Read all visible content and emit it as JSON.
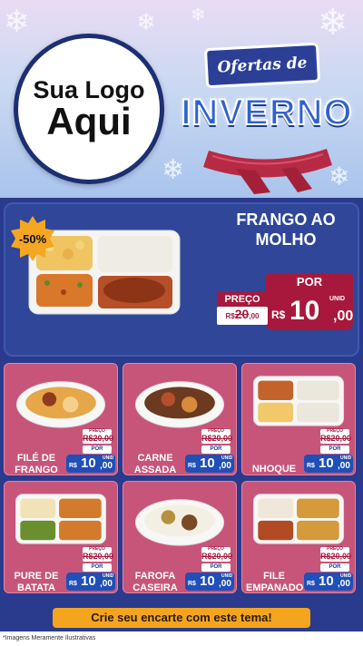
{
  "header": {
    "logo_line1": "Sua Logo",
    "logo_line2": "Aqui",
    "ofertas": "Ofertas de",
    "inverno": "INVERNO"
  },
  "hero": {
    "badge": "-50%",
    "title_line1": "FRANGO AO",
    "title_line2": "MOLHO",
    "por_label": "POR",
    "preco_label": "PREÇO",
    "old_currency": "R$",
    "old_value": "20",
    "old_cents": ",00",
    "currency": "R$",
    "price": "10",
    "cents": ",00",
    "unit": "UNID"
  },
  "products": [
    {
      "name_line1": "FILÉ DE",
      "name_line2": "FRANGO",
      "preco": "PREÇO",
      "old": "R$20,00",
      "por": "POR",
      "currency": "R$",
      "price": "10",
      "cents": ",00",
      "unit": "UNID"
    },
    {
      "name_line1": "CARNE",
      "name_line2": "ASSADA",
      "preco": "PREÇO",
      "old": "R$20,00",
      "por": "POR",
      "currency": "R$",
      "price": "10",
      "cents": ",00",
      "unit": "UNID"
    },
    {
      "name_line1": "NHOQUE",
      "name_line2": "",
      "preco": "PREÇO",
      "old": "R$20,00",
      "por": "POR",
      "currency": "R$",
      "price": "10",
      "cents": ",00",
      "unit": "UNID"
    },
    {
      "name_line1": "PURE DE",
      "name_line2": "BATATA",
      "preco": "PREÇO",
      "old": "R$20,00",
      "por": "POR",
      "currency": "R$",
      "price": "10",
      "cents": ",00",
      "unit": "UNID"
    },
    {
      "name_line1": "FAROFA",
      "name_line2": "CASEIRA",
      "preco": "PREÇO",
      "old": "R$20,00",
      "por": "POR",
      "currency": "R$",
      "price": "10",
      "cents": ",00",
      "unit": "UNID"
    },
    {
      "name_line1": "FILE",
      "name_line2": "EMPANADO",
      "preco": "PREÇO",
      "old": "R$20,00",
      "por": "POR",
      "currency": "R$",
      "price": "10",
      "cents": ",00",
      "unit": "UNID"
    }
  ],
  "cta": "Crie seu encarte com este tema!",
  "disclaimer": "*Imagens Meramente Ilustrativas",
  "colors": {
    "navy": "#2a3a8c",
    "pink_card": "#c7557a",
    "price_red": "#a8183c",
    "price_blue": "#1f4fb7",
    "cta_orange": "#f4a51f"
  }
}
